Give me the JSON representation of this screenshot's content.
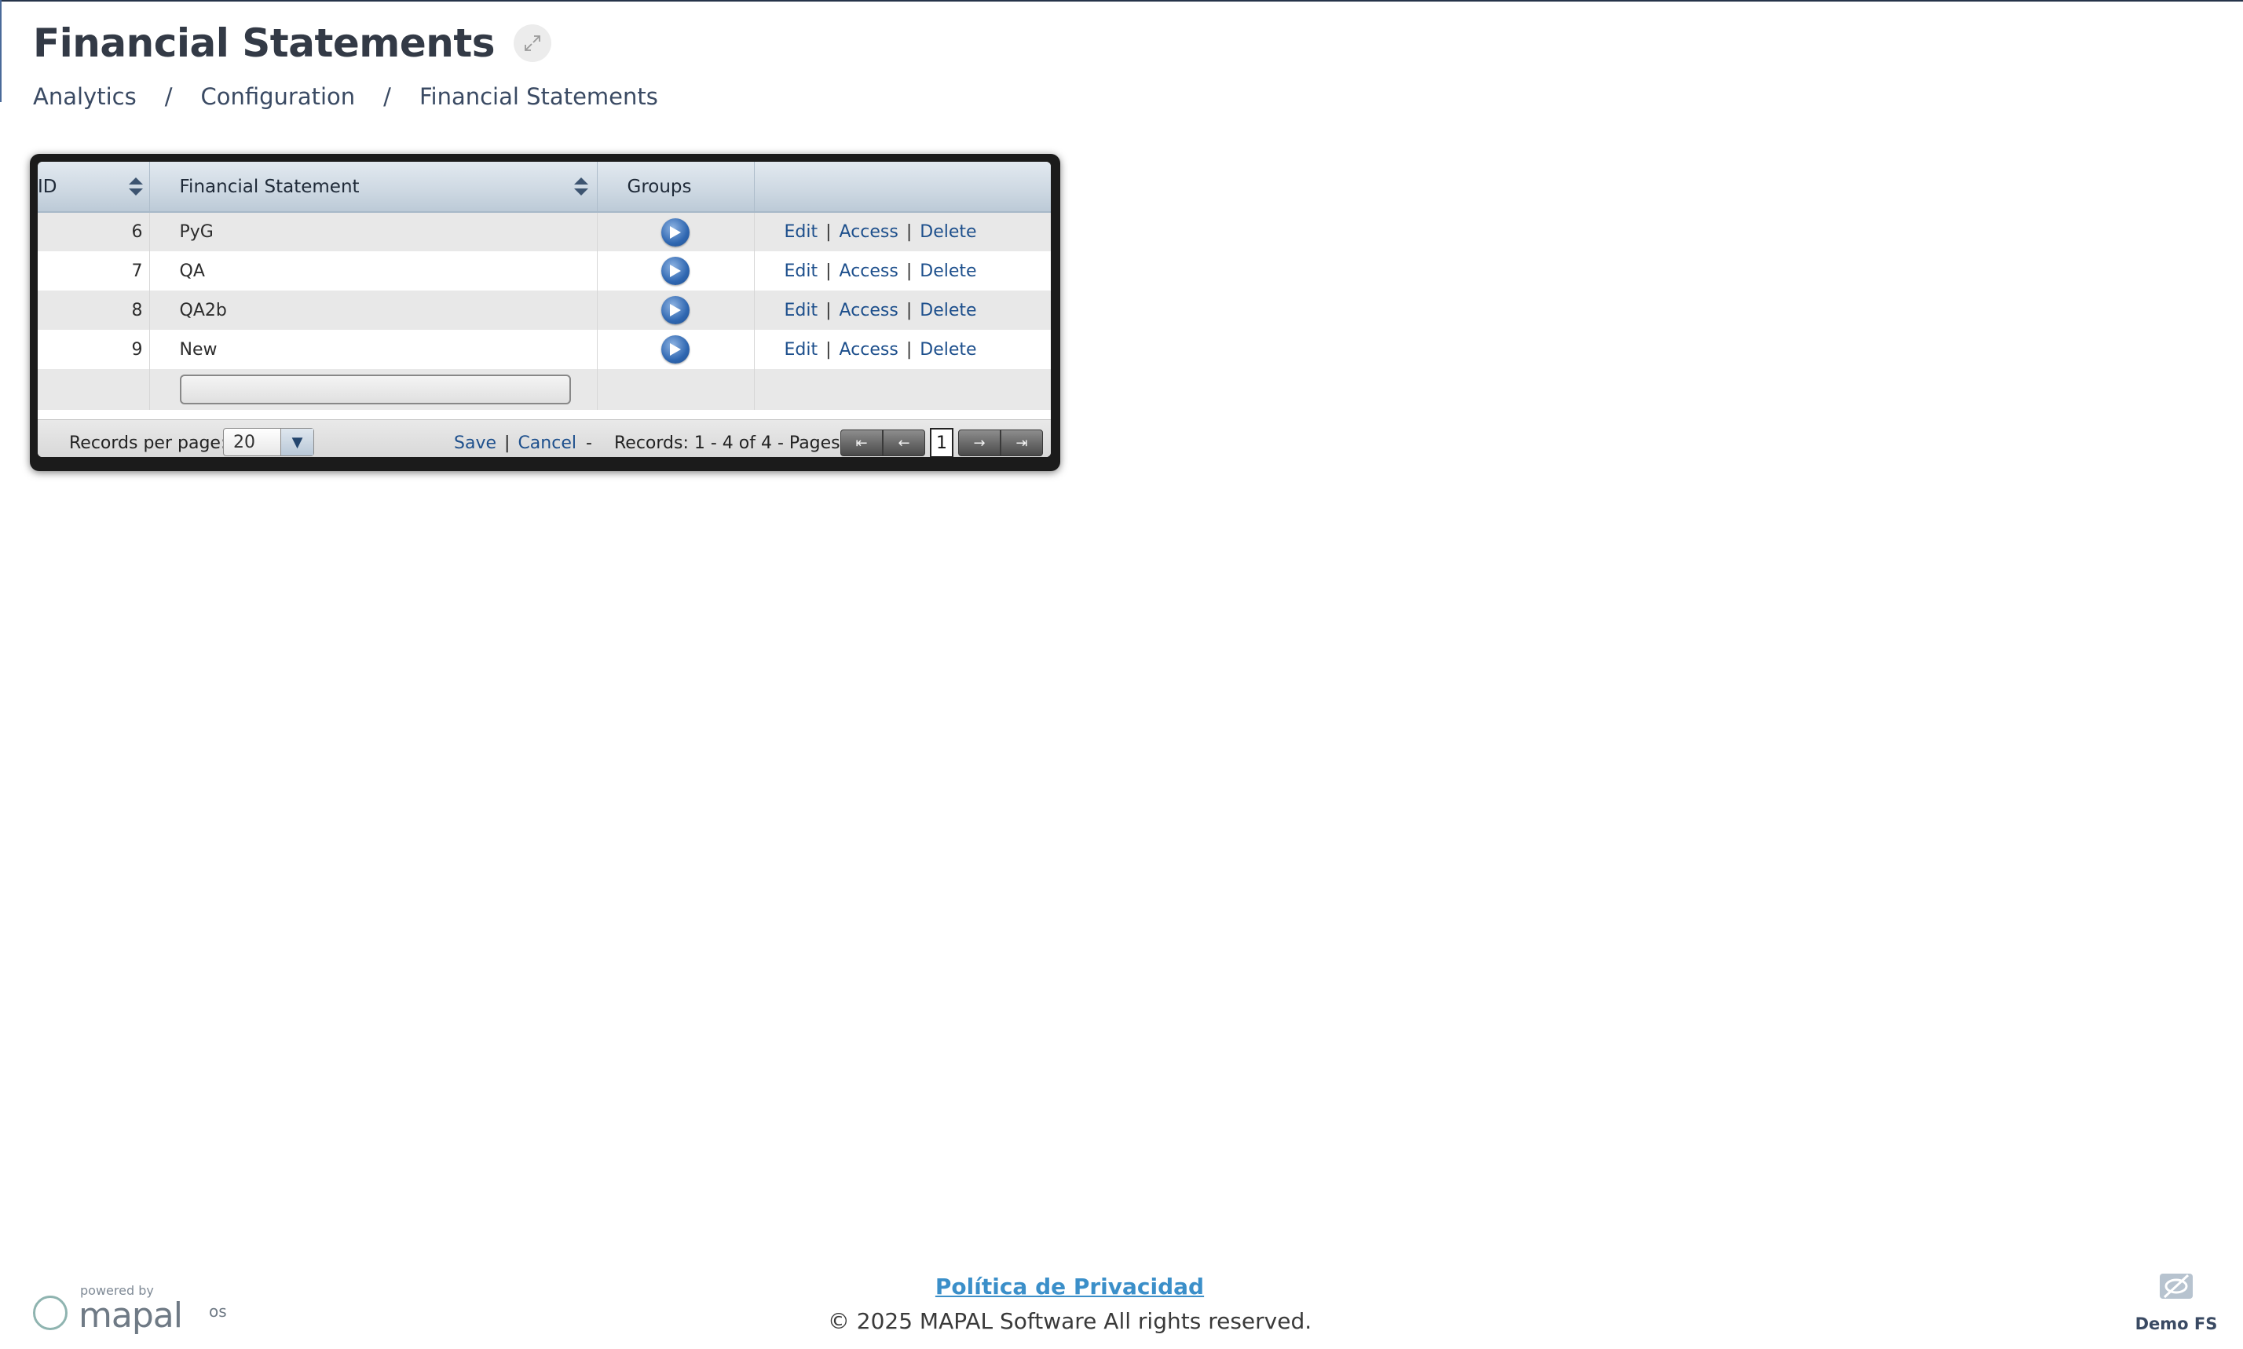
{
  "header": {
    "title": "Financial Statements",
    "expand_icon": "expand-icon"
  },
  "breadcrumb": {
    "items": [
      "Analytics",
      "Configuration",
      "Financial Statements"
    ],
    "separator": "/"
  },
  "grid": {
    "columns": [
      "ID",
      "Financial Statement",
      "Groups",
      ""
    ],
    "rows": [
      {
        "id": "6",
        "name": "PyG"
      },
      {
        "id": "7",
        "name": "QA"
      },
      {
        "id": "8",
        "name": "QA2b"
      },
      {
        "id": "9",
        "name": "New"
      }
    ],
    "actions": {
      "edit": "Edit",
      "access": "Access",
      "delete": "Delete",
      "pipe": "|"
    },
    "new_row_input_value": "",
    "footer": {
      "records_per_page_label": "Records per page:",
      "records_per_page_value": "20",
      "save": "Save",
      "cancel": "Cancel",
      "dash": "-",
      "records_text": "Records: 1 - 4 of 4 - Pages:",
      "current_page": "1"
    }
  },
  "footer": {
    "privacy": "Política de Privacidad",
    "copyright": "© 2025 MAPAL Software All rights reserved.",
    "powered_by": "powered by",
    "brand": "mapal",
    "brand_suffix": "os",
    "demo_label": "Demo FS"
  },
  "colors": {
    "title": "#333a46",
    "link": "#1d4f8c",
    "privacy_link": "#3b8fc9",
    "header_gradient": "#cdd8e2"
  }
}
